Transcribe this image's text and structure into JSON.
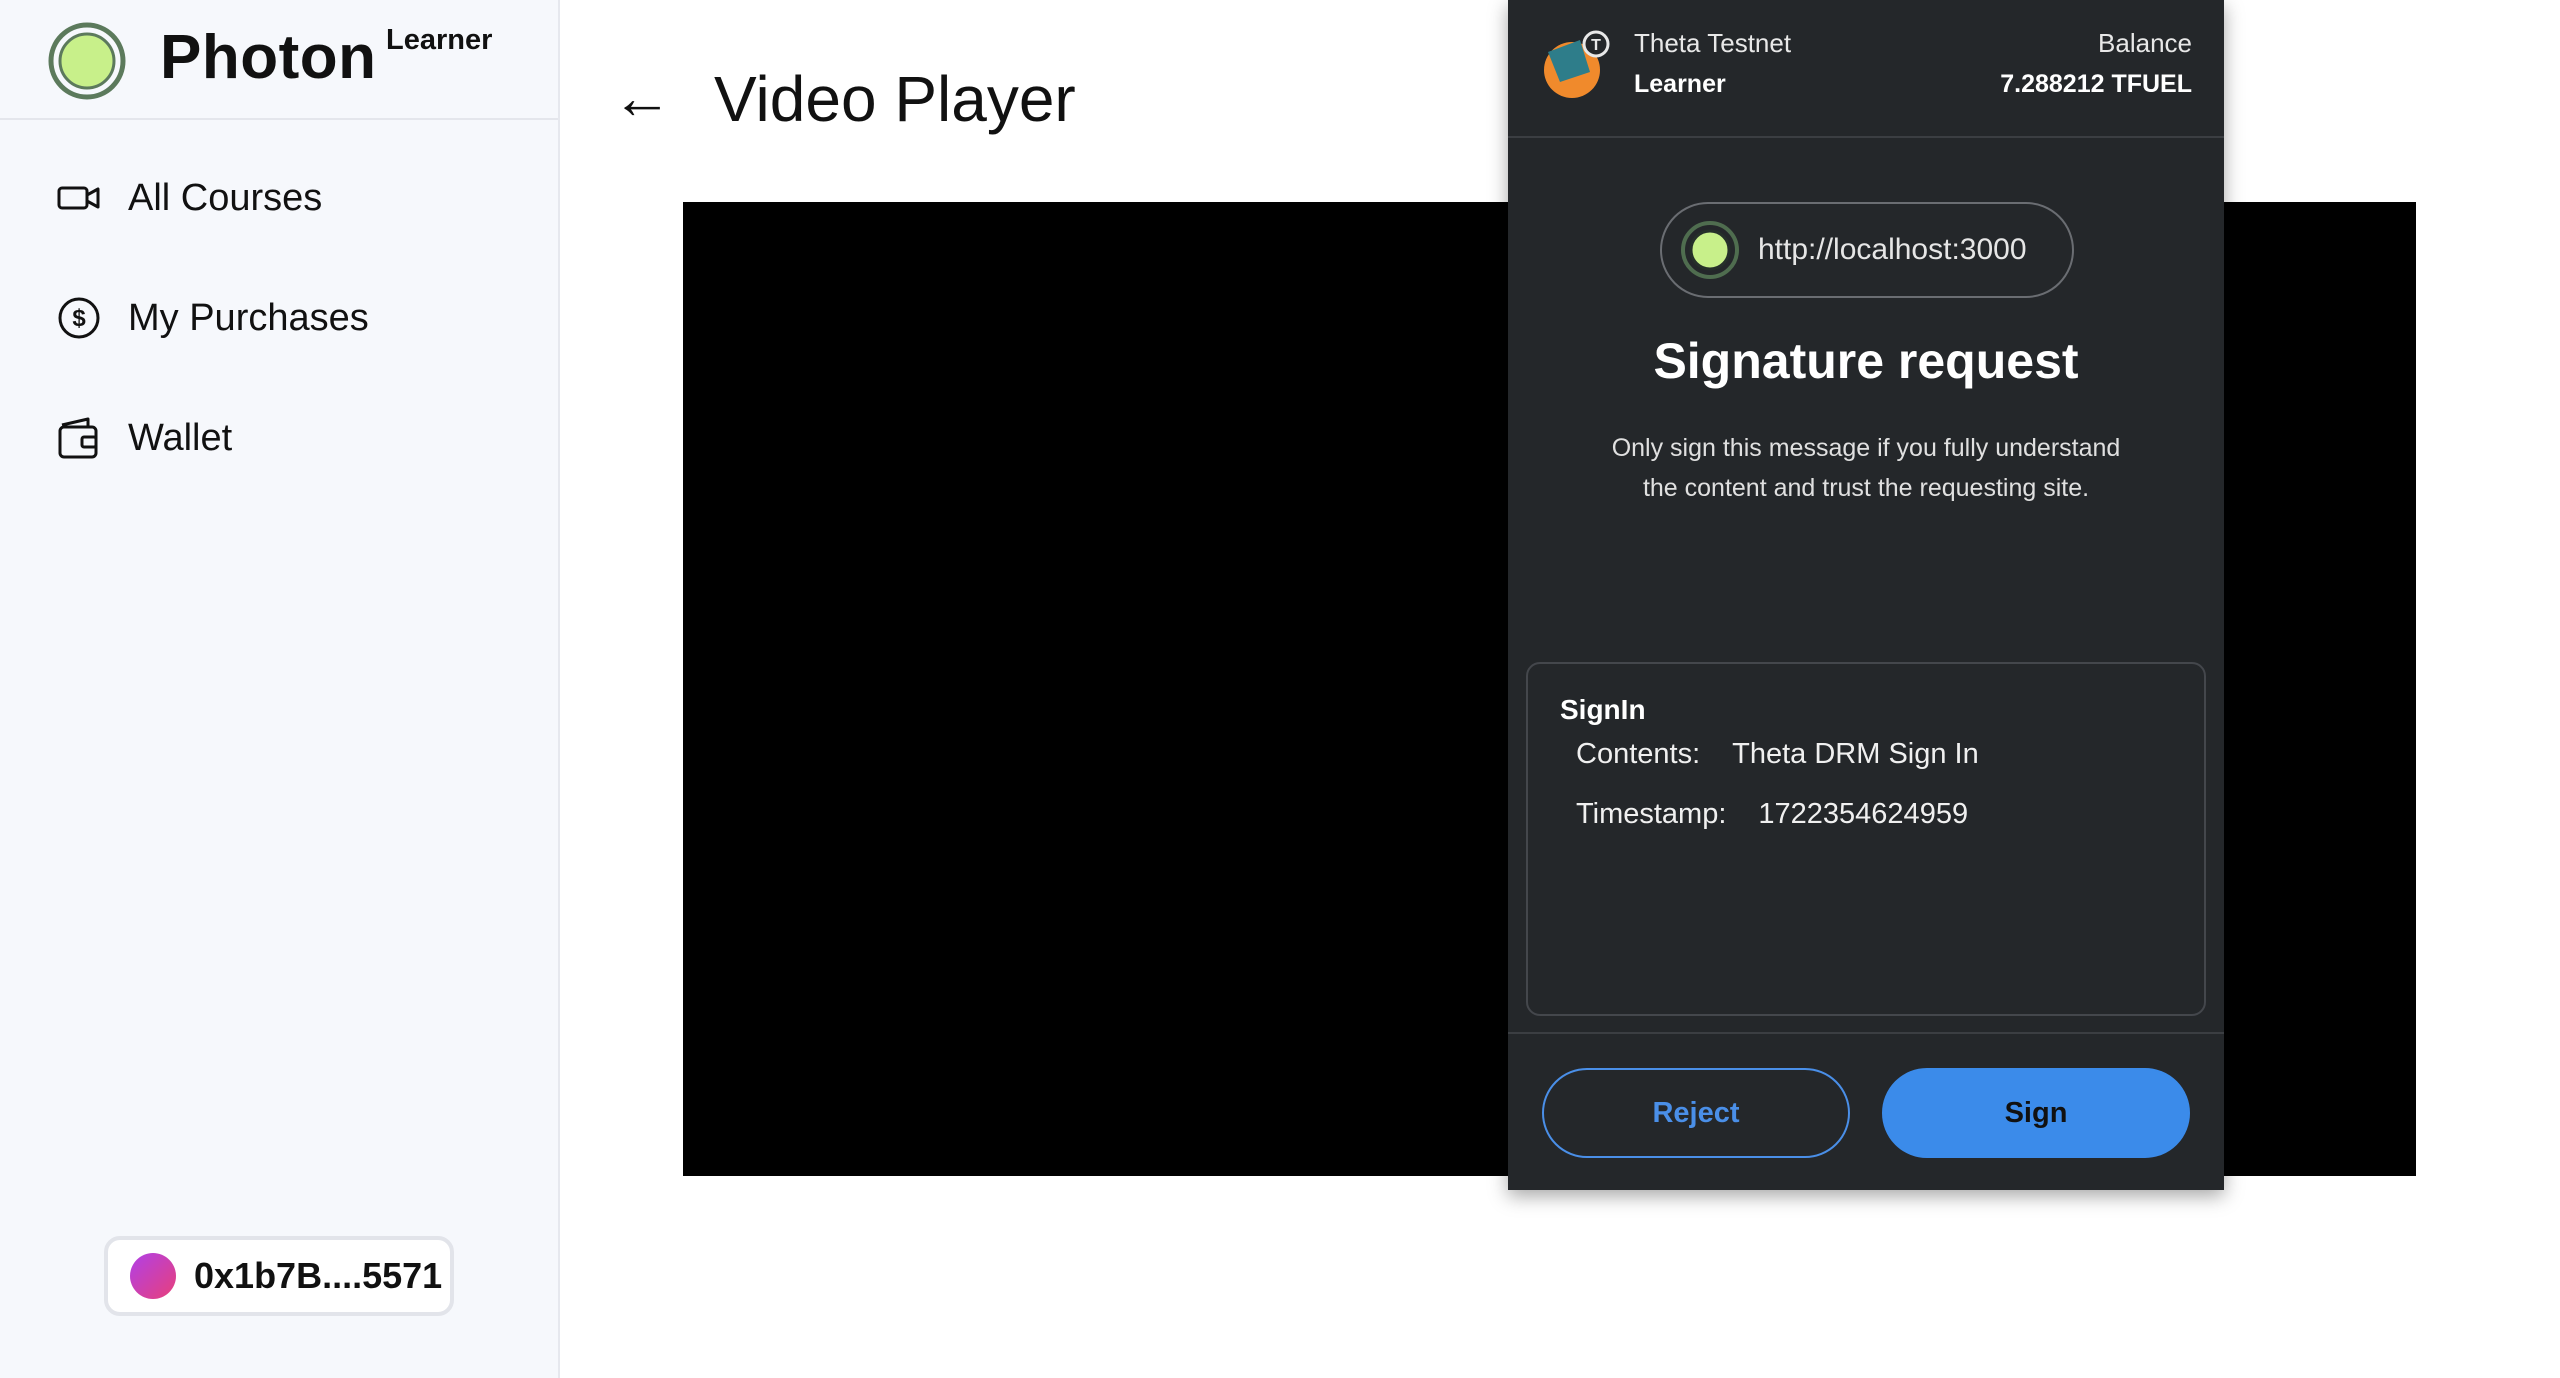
{
  "sidebar": {
    "brand_name": "Photon",
    "brand_role": "Learner",
    "nav": [
      {
        "label": "All Courses",
        "icon": "video-camera-icon"
      },
      {
        "label": "My Purchases",
        "icon": "dollar-circle-icon"
      },
      {
        "label": "Wallet",
        "icon": "wallet-icon"
      }
    ],
    "wallet_address": "0x1b7B....5571"
  },
  "main": {
    "back_label": "←",
    "title": "Video Player"
  },
  "popup": {
    "network": "Theta Testnet",
    "account": "Learner",
    "balance_label": "Balance",
    "balance_value": "7.288212 TFUEL",
    "origin": "http://localhost:3000",
    "title": "Signature request",
    "warning": "Only sign this message if you fully understand the content and trust the requesting site.",
    "message": {
      "type": "SignIn",
      "rows": [
        {
          "key": "Contents:",
          "value": "Theta DRM Sign In"
        },
        {
          "key": "Timestamp:",
          "value": "1722354624959"
        }
      ]
    },
    "reject_label": "Reject",
    "sign_label": "Sign"
  },
  "colors": {
    "accent_green": "#c8f08a",
    "accent_blue": "#3b8bea",
    "popup_bg": "#24272a"
  }
}
